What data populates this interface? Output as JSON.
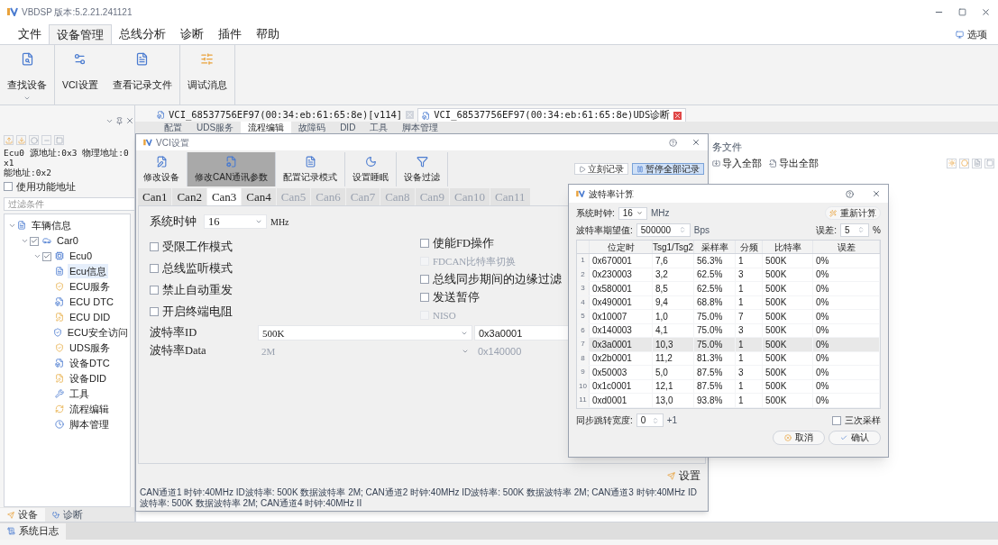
{
  "window": {
    "title": "VBDSP 版本:5.2.21.241121"
  },
  "menu": [
    {
      "label": "文件",
      "selected": false
    },
    {
      "label": "设备管理",
      "selected": true
    },
    {
      "label": "总线分析",
      "selected": false
    },
    {
      "label": "诊断",
      "selected": false
    },
    {
      "label": "插件",
      "selected": false
    },
    {
      "label": "帮助",
      "selected": false
    }
  ],
  "options": {
    "label": "选项"
  },
  "ribbon": [
    {
      "label": "查找设备",
      "dropdown": true
    },
    {
      "label": "VCI设置",
      "dropdown": false
    },
    {
      "label": "查看记录文件",
      "dropdown": false
    },
    {
      "label": "调试消息",
      "dropdown": false
    }
  ],
  "sidebar": {
    "address_lines": [
      "Ecu0 源地址:0x3 物理地址:0x1",
      "能地址:0x2"
    ],
    "use_functional": {
      "label": "使用功能地址",
      "checked": false
    },
    "filter": {
      "placeholder": "过滤条件"
    },
    "tree": [
      {
        "label": "车辆信息",
        "expanded": true,
        "selected": false,
        "children": [
          {
            "label": "Car0",
            "checked": true,
            "expanded": true,
            "selected": false,
            "children": [
              {
                "label": "Ecu0",
                "checked": true,
                "expanded": true,
                "selected": false,
                "children": [
                  {
                    "label": "Ecu信息",
                    "selected": true
                  },
                  {
                    "label": "ECU服务",
                    "selected": false
                  },
                  {
                    "label": "ECU DTC",
                    "selected": false
                  },
                  {
                    "label": "ECU DID",
                    "selected": false
                  },
                  {
                    "label": "ECU安全访问",
                    "selected": false
                  },
                  {
                    "label": "UDS服务",
                    "selected": false
                  },
                  {
                    "label": "设备DTC",
                    "selected": false
                  },
                  {
                    "label": "设备DID",
                    "selected": false
                  },
                  {
                    "label": "工具",
                    "selected": false
                  },
                  {
                    "label": "流程编辑",
                    "selected": false
                  },
                  {
                    "label": "脚本管理",
                    "selected": false
                  }
                ]
              }
            ]
          }
        ]
      }
    ],
    "bottom_tabs": [
      {
        "label": "设备",
        "selected": true
      },
      {
        "label": "诊断",
        "selected": false
      }
    ]
  },
  "log_bar": {
    "label": "系统日志"
  },
  "document_tabs": [
    {
      "label": "VCI_68537756EF97(00:34:eb:61:65:8e)[v114]",
      "selected": false
    },
    {
      "label": "VCI_68537756EF97(00:34:eb:61:65:8e)UDS诊断",
      "selected": true
    }
  ],
  "sub_tabs": [
    {
      "label": "配置",
      "selected": false
    },
    {
      "label": "UDS服务",
      "selected": false
    },
    {
      "label": "流程编辑",
      "selected": true
    },
    {
      "label": "故障码",
      "selected": false
    },
    {
      "label": "DID",
      "selected": false
    },
    {
      "label": "工具",
      "selected": false
    },
    {
      "label": "脚本管理",
      "selected": false
    }
  ],
  "right_pane": {
    "heading": "务文件",
    "buttons": [
      "导入全部",
      "导出全部"
    ]
  },
  "vci_dialog": {
    "title": "VCI设置",
    "toolbar": [
      {
        "label": "修改设备",
        "selected": false
      },
      {
        "label": "修改CAN通讯参数",
        "selected": true
      },
      {
        "label": "配置记录模式",
        "selected": false
      },
      {
        "label": "设置睡眠",
        "selected": false
      },
      {
        "label": "设备过滤",
        "selected": false
      }
    ],
    "record_buttons": [
      {
        "label": "立刻记录",
        "selected": false
      },
      {
        "label": "暂停全部记录",
        "selected": true
      }
    ],
    "can_tabs": [
      {
        "label": "Can1",
        "selected": false,
        "disabled": false
      },
      {
        "label": "Can2",
        "selected": false,
        "disabled": false
      },
      {
        "label": "Can3",
        "selected": true,
        "disabled": false
      },
      {
        "label": "Can4",
        "selected": false,
        "disabled": false
      },
      {
        "label": "Can5",
        "selected": false,
        "disabled": true
      },
      {
        "label": "Can6",
        "selected": false,
        "disabled": true
      },
      {
        "label": "Can7",
        "selected": false,
        "disabled": true
      },
      {
        "label": "Can8",
        "selected": false,
        "disabled": true
      },
      {
        "label": "Can9",
        "selected": false,
        "disabled": true
      },
      {
        "label": "Can10",
        "selected": false,
        "disabled": true
      },
      {
        "label": "Can11",
        "selected": false,
        "disabled": true
      }
    ],
    "clock": {
      "label": "系统时钟",
      "value": "16",
      "unit": "MHz"
    },
    "options_left": [
      {
        "label": "受限工作模式",
        "checked": false,
        "disabled": false
      },
      {
        "label": "总线监听模式",
        "checked": false,
        "disabled": false
      },
      {
        "label": "禁止自动重发",
        "checked": false,
        "disabled": false
      },
      {
        "label": "开启终端电阻",
        "checked": false,
        "disabled": false
      }
    ],
    "options_right": [
      {
        "label": "使能FD操作",
        "checked": false,
        "disabled": false
      },
      {
        "label": "FDCAN比特率切换",
        "checked": false,
        "disabled": true
      },
      {
        "label": "总线同步期间的边缘过滤",
        "checked": false,
        "disabled": false
      },
      {
        "label": "发送暂停",
        "checked": false,
        "disabled": false
      },
      {
        "label": "NISO",
        "checked": false,
        "disabled": true
      }
    ],
    "baud_rows": [
      {
        "label": "波特率ID",
        "value": "500K",
        "code": "0x3a0001",
        "disabled": false
      },
      {
        "label": "波特率Data",
        "value": "2M",
        "code": "0x140000",
        "disabled": true
      }
    ],
    "apply_button": "设置",
    "status": "CAN通道1 时钟:40MHz ID波特率: 500K 数据波特率 2M; CAN通道2 时钟:40MHz ID波特率: 500K 数据波特率 2M; CAN通道3 时钟:40MHz ID波特率: 500K 数据波特率 2M; CAN通道4 时钟:40MHz II"
  },
  "calc_dialog": {
    "title": "波特率计算",
    "clock": {
      "label": "系统时钟:",
      "value": "16",
      "unit": "MHz"
    },
    "recalc_button": "重新计算",
    "expected": {
      "label": "波特率期望值:",
      "value": "500000",
      "unit": "Bps"
    },
    "tolerance": {
      "label": "误差:",
      "value": "5",
      "unit": "%"
    },
    "table": {
      "columns": [
        "位定时",
        "Tsg1/Tsg2",
        "采样率",
        "分频",
        "比特率",
        "误差"
      ],
      "rows": [
        {
          "index": "1",
          "cells": [
            "0x670001",
            "7,6",
            "56.3%",
            "1",
            "500K",
            "0%"
          ],
          "selected": false
        },
        {
          "index": "2",
          "cells": [
            "0x230003",
            "3,2",
            "62.5%",
            "3",
            "500K",
            "0%"
          ],
          "selected": false
        },
        {
          "index": "3",
          "cells": [
            "0x580001",
            "8,5",
            "62.5%",
            "1",
            "500K",
            "0%"
          ],
          "selected": false
        },
        {
          "index": "4",
          "cells": [
            "0x490001",
            "9,4",
            "68.8%",
            "1",
            "500K",
            "0%"
          ],
          "selected": false
        },
        {
          "index": "5",
          "cells": [
            "0x10007",
            "1,0",
            "75.0%",
            "7",
            "500K",
            "0%"
          ],
          "selected": false
        },
        {
          "index": "6",
          "cells": [
            "0x140003",
            "4,1",
            "75.0%",
            "3",
            "500K",
            "0%"
          ],
          "selected": false
        },
        {
          "index": "7",
          "cells": [
            "0x3a0001",
            "10,3",
            "75.0%",
            "1",
            "500K",
            "0%"
          ],
          "selected": true
        },
        {
          "index": "8",
          "cells": [
            "0x2b0001",
            "11,2",
            "81.3%",
            "1",
            "500K",
            "0%"
          ],
          "selected": false
        },
        {
          "index": "9",
          "cells": [
            "0x50003",
            "5,0",
            "87.5%",
            "3",
            "500K",
            "0%"
          ],
          "selected": false
        },
        {
          "index": "10",
          "cells": [
            "0x1c0001",
            "12,1",
            "87.5%",
            "1",
            "500K",
            "0%"
          ],
          "selected": false
        },
        {
          "index": "11",
          "cells": [
            "0xd0001",
            "13,0",
            "93.8%",
            "1",
            "500K",
            "0%"
          ],
          "selected": false
        }
      ]
    },
    "sjw": {
      "label": "同步跳转宽度:",
      "value": "0",
      "unit": "+1"
    },
    "triple_sampling": {
      "label": "三次采样",
      "checked": false
    },
    "cancel_button": "取消",
    "ok_button": "确认"
  }
}
